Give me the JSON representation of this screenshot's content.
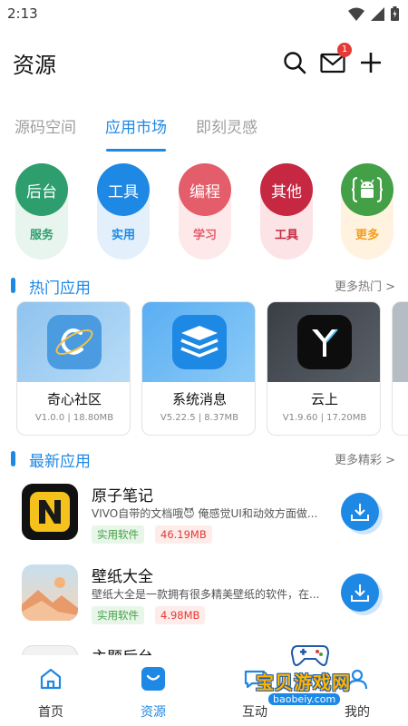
{
  "status_bar": {
    "time": "2:13"
  },
  "header": {
    "title": "资源",
    "notification_count": "1"
  },
  "tabs": [
    {
      "label": "源码空间"
    },
    {
      "label": "应用市场"
    },
    {
      "label": "即刻灵感"
    }
  ],
  "categories": [
    {
      "label": "后台",
      "sub": "服务",
      "color": "#2e9e6e",
      "sub_color": "#2e9e6e"
    },
    {
      "label": "工具",
      "sub": "实用",
      "color": "#1e88e5",
      "sub_color": "#1e88e5"
    },
    {
      "label": "编程",
      "sub": "学习",
      "color": "#e35d6a",
      "sub_color": "#e35d6a"
    },
    {
      "label": "其他",
      "sub": "工具",
      "color": "#c62842",
      "sub_color": "#c62842"
    },
    {
      "label": "",
      "sub": "更多",
      "color": "#43a047",
      "sub_color": "#f59c1a",
      "icon": "android-icon"
    }
  ],
  "hot_section": {
    "title": "热门应用",
    "more": "更多热门 >"
  },
  "hot_apps": [
    {
      "name": "奇心社区",
      "meta": "V1.0.0 | 18.80MB"
    },
    {
      "name": "系统消息",
      "meta": "V5.22.5 | 8.37MB"
    },
    {
      "name": "云上",
      "meta": "V1.9.60 | 17.20MB"
    }
  ],
  "latest_section": {
    "title": "最新应用",
    "more": "更多精彩 >"
  },
  "latest_apps": [
    {
      "name": "原子笔记",
      "desc": "VIVO自带的文档哦😈 俺感觉UI和动效方面做...",
      "category": "实用软件",
      "size": "46.19MB"
    },
    {
      "name": "壁纸大全",
      "desc": "壁纸大全是一款拥有很多精美壁纸的软件，在...",
      "category": "实用软件",
      "size": "4.98MB"
    },
    {
      "name": "主题后台"
    }
  ],
  "bottom_nav": [
    {
      "label": "首页"
    },
    {
      "label": "资源"
    },
    {
      "label": "互动"
    },
    {
      "label": "我的"
    }
  ],
  "watermark": {
    "text": "宝贝游戏网",
    "url": "baobeiy.com"
  },
  "colors": {
    "accent": "#1e88e5"
  }
}
